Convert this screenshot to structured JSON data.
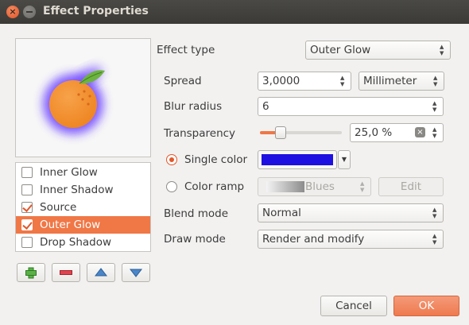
{
  "window": {
    "title": "Effect Properties"
  },
  "effects": [
    {
      "label": "Inner Glow",
      "checked": false,
      "selected": false
    },
    {
      "label": "Inner Shadow",
      "checked": false,
      "selected": false
    },
    {
      "label": "Source",
      "checked": true,
      "selected": false
    },
    {
      "label": "Outer Glow",
      "checked": true,
      "selected": true
    },
    {
      "label": "Drop Shadow",
      "checked": false,
      "selected": false
    }
  ],
  "effect_type": {
    "label": "Effect type",
    "value": "Outer Glow"
  },
  "spread": {
    "label": "Spread",
    "value": "3,0000",
    "unit": "Millimeter"
  },
  "blur_radius": {
    "label": "Blur radius",
    "value": "6"
  },
  "transparency": {
    "label": "Transparency",
    "value": "25,0 %",
    "fraction": 0.25
  },
  "color_mode": {
    "single_label": "Single color",
    "single_checked": true,
    "ramp_label": "Color ramp",
    "ramp_checked": false,
    "single_color": "#1e10e0",
    "ramp_value": "Blues",
    "edit_label": "Edit"
  },
  "blend_mode": {
    "label": "Blend mode",
    "value": "Normal"
  },
  "draw_mode": {
    "label": "Draw mode",
    "value": "Render and modify"
  },
  "buttons": {
    "cancel": "Cancel",
    "ok": "OK"
  },
  "toolbar": {
    "add_icon": "add-icon",
    "remove_icon": "remove-icon",
    "up_icon": "arrow-up-icon",
    "down_icon": "arrow-down-icon"
  }
}
